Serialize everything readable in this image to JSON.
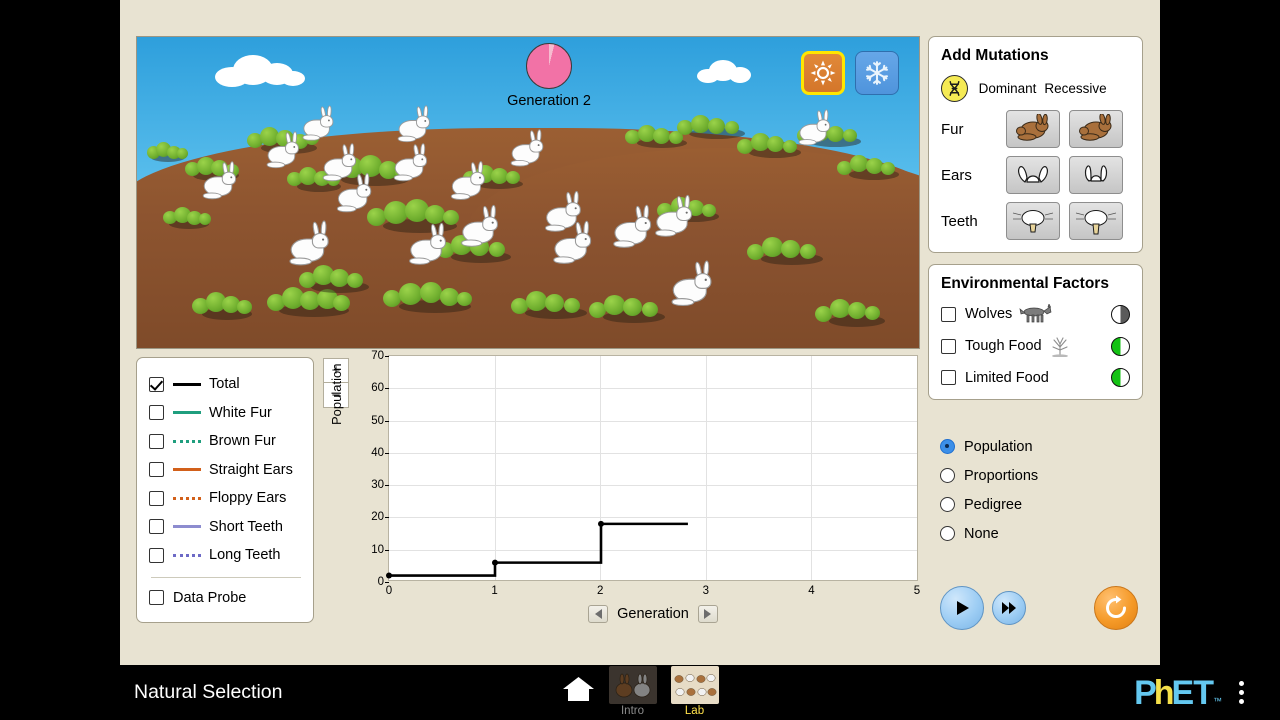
{
  "app": {
    "title": "Natural Selection"
  },
  "environment": {
    "generation_label": "Generation 2",
    "clock_elapsed_fraction": 0.04,
    "climate": {
      "sun_icon": "sun-icon",
      "snow_icon": "snowflake-icon",
      "selected": "sun"
    },
    "rabbit_count_visible": 18,
    "fur_color": "white",
    "ground_color": "#8e5530",
    "sky_color": "#60c3ef"
  },
  "mutations": {
    "title": "Add Mutations",
    "dna_icon": "dna-icon",
    "columns": [
      "Dominant",
      "Recessive"
    ],
    "rows": [
      {
        "label": "Fur",
        "dominant_icon": "brown-fur-rabbit-icon",
        "recessive_icon": "brown-fur-rabbit-icon"
      },
      {
        "label": "Ears",
        "dominant_icon": "straight-ears-icon",
        "recessive_icon": "floppy-ears-icon"
      },
      {
        "label": "Teeth",
        "dominant_icon": "short-teeth-icon",
        "recessive_icon": "long-teeth-icon"
      }
    ]
  },
  "environmental_factors": {
    "title": "Environmental Factors",
    "items": [
      {
        "label": "Wolves",
        "checked": false,
        "icon": "wolf-icon",
        "pie_color": "#5a5a5a",
        "pie_fraction": 0.5
      },
      {
        "label": "Tough Food",
        "checked": false,
        "icon": "tough-food-icon",
        "pie_color": "#14c214",
        "pie_fraction": 0.5
      },
      {
        "label": "Limited Food",
        "checked": false,
        "icon": "limited-food-icon",
        "pie_color": "#14c214",
        "pie_fraction": 0.5
      }
    ]
  },
  "graph_modes": {
    "selected": "Population",
    "options": [
      "Population",
      "Proportions",
      "Pedigree",
      "None"
    ]
  },
  "legend": {
    "items": [
      {
        "label": "Total",
        "checked": true,
        "color": "#000000",
        "style": "solid"
      },
      {
        "label": "White Fur",
        "checked": false,
        "color": "#1f9e7e",
        "style": "solid"
      },
      {
        "label": "Brown Fur",
        "checked": false,
        "color": "#1f9e7e",
        "style": "dotted"
      },
      {
        "label": "Straight Ears",
        "checked": false,
        "color": "#d2601a",
        "style": "solid"
      },
      {
        "label": "Floppy Ears",
        "checked": false,
        "color": "#d2601a",
        "style": "dotted"
      },
      {
        "label": "Short Teeth",
        "checked": false,
        "color": "#8d8ccf",
        "style": "solid"
      },
      {
        "label": "Long Teeth",
        "checked": false,
        "color": "#6d6ac6",
        "style": "dotted"
      }
    ],
    "data_probe": {
      "label": "Data Probe",
      "checked": false
    }
  },
  "zoom_controls": {
    "in_label": "+",
    "out_label": "−"
  },
  "generation_control": {
    "label": "Generation",
    "back_icon": "triangle-left-icon",
    "forward_icon": "triangle-right-icon"
  },
  "transport": {
    "play_icon": "play-icon",
    "fast_forward_icon": "fast-forward-icon",
    "reset_icon": "reset-all-icon"
  },
  "navbar": {
    "home_icon": "home-icon",
    "tabs": [
      {
        "label": "Intro",
        "selected": false
      },
      {
        "label": "Lab",
        "selected": true
      }
    ],
    "logo": {
      "part1": "P",
      "part2": "h",
      "part3": "ET",
      "tm": "™"
    },
    "menu_icon": "kebab-menu-icon"
  },
  "chart_data": {
    "type": "line",
    "title": "",
    "xlabel": "Generation",
    "ylabel": "Population",
    "xlim": [
      0,
      5
    ],
    "ylim": [
      0,
      70
    ],
    "xticks": [
      0,
      1,
      2,
      3,
      4,
      5
    ],
    "yticks": [
      0,
      10,
      20,
      30,
      40,
      50,
      60,
      70
    ],
    "grid": true,
    "legend_position": "left-panel",
    "step_style": "step-after",
    "series": [
      {
        "name": "Total",
        "color": "#000000",
        "style": "solid",
        "x": [
          0,
          1,
          2,
          2.82
        ],
        "values": [
          2,
          6,
          18,
          18
        ]
      }
    ]
  }
}
